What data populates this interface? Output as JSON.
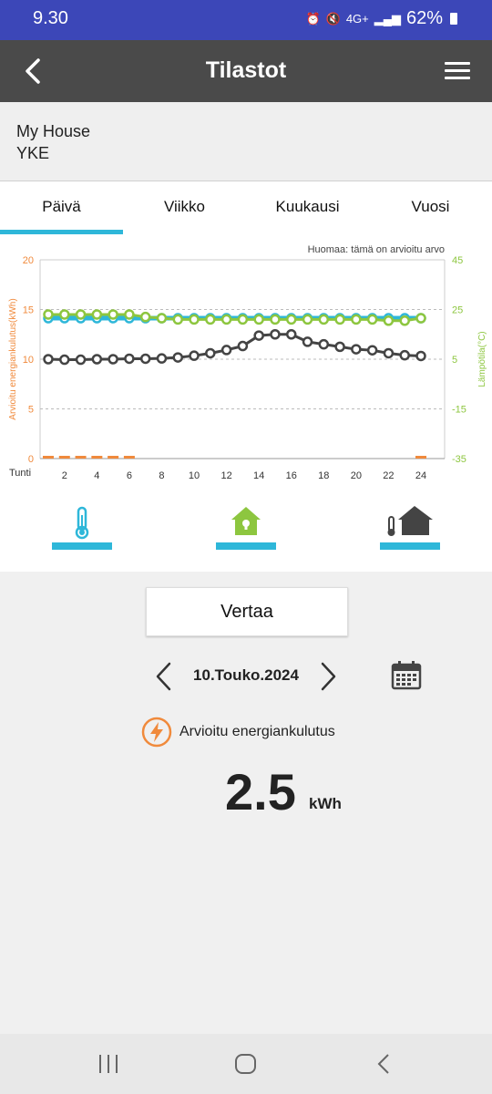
{
  "status": {
    "time": "9.30",
    "battery": "62%",
    "network": "4G+"
  },
  "header": {
    "title": "Tilastot"
  },
  "house": {
    "name": "My House",
    "subtitle": "YKE"
  },
  "tabs": [
    "Päivä",
    "Viikko",
    "Kuukausi",
    "Vuosi"
  ],
  "active_tab": 0,
  "chart_note": "Huomaa: tämä on arvioitu arvo",
  "chart_data": {
    "type": "line",
    "xlabel": "Tunti",
    "ylabel_left": "Arvioitu energiankulutus(kWh)",
    "ylabel_right": "Lämpötila(°C)",
    "x": [
      1,
      2,
      3,
      4,
      5,
      6,
      7,
      8,
      9,
      10,
      11,
      12,
      13,
      14,
      15,
      16,
      17,
      18,
      19,
      20,
      21,
      22,
      23,
      24
    ],
    "x_ticks": [
      2,
      4,
      6,
      8,
      10,
      12,
      14,
      16,
      18,
      20,
      22,
      24
    ],
    "y_left": {
      "ticks": [
        0,
        5,
        10,
        15,
        20
      ],
      "lim": [
        0,
        20
      ]
    },
    "y_right": {
      "ticks": [
        -35,
        -15,
        5,
        25,
        45
      ],
      "lim": [
        -35,
        45
      ]
    },
    "series": [
      {
        "axis": "left",
        "type": "bar",
        "color": "#f08a3c",
        "values": [
          0.1,
          0.1,
          0.1,
          0.1,
          0.1,
          0.1,
          0,
          0,
          0,
          0,
          0,
          0,
          0,
          0,
          0,
          0,
          0,
          0,
          0,
          0,
          0,
          0,
          0,
          0.2
        ]
      },
      {
        "axis": "right",
        "color": "#2eb7d9",
        "values": [
          21.5,
          21.5,
          21.5,
          21.5,
          21.5,
          21.5,
          21.5,
          21.5,
          21.5,
          21.5,
          21.5,
          21.5,
          21.5,
          21.5,
          21.5,
          21.5,
          21.5,
          21.5,
          21.5,
          21.5,
          21.5,
          21.5,
          21.5,
          21.5
        ]
      },
      {
        "axis": "right",
        "color": "#8dc63f",
        "values": [
          23,
          23,
          23,
          23,
          23,
          23,
          22,
          21.5,
          21,
          21,
          21,
          21,
          21,
          21,
          21,
          21,
          21,
          21,
          21,
          21,
          21,
          20.5,
          20.5,
          21.5
        ]
      },
      {
        "axis": "right",
        "color": "#444444",
        "values": [
          5,
          4.8,
          4.8,
          5,
          5,
          5.2,
          5.2,
          5.3,
          5.7,
          6.4,
          7.4,
          8.7,
          10.3,
          14.5,
          15,
          15,
          12,
          11,
          10,
          9,
          8.6,
          7.4,
          6.6,
          6.3
        ]
      }
    ]
  },
  "modes": [
    {
      "name": "indoor-temp-mode",
      "icon": "thermometer-icon"
    },
    {
      "name": "home-mode",
      "icon": "house-icon"
    },
    {
      "name": "outdoor-temp-mode",
      "icon": "thermometer-house-icon"
    }
  ],
  "compare_label": "Vertaa",
  "date": "10.Touko.2024",
  "energy": {
    "label": "Arvioitu energiankulutus",
    "value": "2.5",
    "unit": "kWh"
  },
  "colors": {
    "accent": "#2eb7d9",
    "energy": "#f08a3c",
    "temp_outdoor": "#8dc63f",
    "appbar": "#4a4a4a",
    "statusbar": "#3c47b8"
  }
}
